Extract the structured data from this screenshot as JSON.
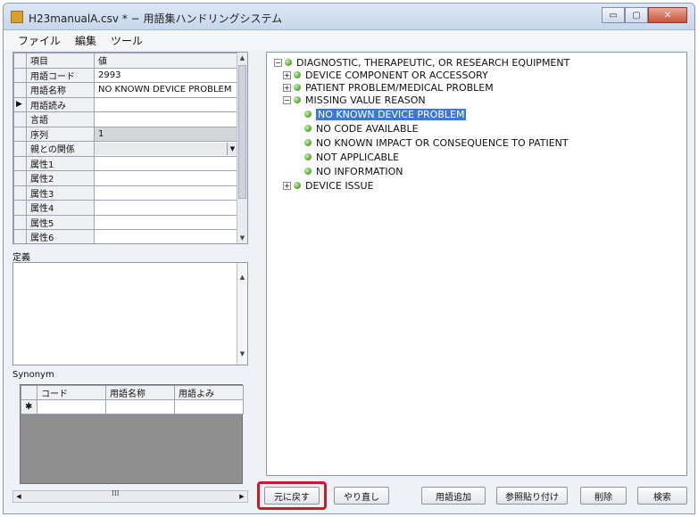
{
  "window": {
    "title": "H23manualA.csv * − 用語集ハンドリングシステム",
    "min": "▭",
    "max": "▢",
    "close": "✕"
  },
  "menu": [
    "ファイル",
    "編集",
    "ツール"
  ],
  "grid": {
    "headers": [
      "項目",
      "値"
    ],
    "current_marker": "▶",
    "rows": [
      {
        "key": "用語コード",
        "value": "2993"
      },
      {
        "key": "用語名称",
        "value": "NO KNOWN DEVICE PROBLEM"
      },
      {
        "key": "用語読み",
        "value": ""
      },
      {
        "key": "言語",
        "value": ""
      },
      {
        "key": "序列",
        "value": "1"
      },
      {
        "key": "親との関係",
        "value": ""
      },
      {
        "key": "属性1",
        "value": ""
      },
      {
        "key": "属性2",
        "value": ""
      },
      {
        "key": "属性3",
        "value": ""
      },
      {
        "key": "属性4",
        "value": ""
      },
      {
        "key": "属性5",
        "value": ""
      },
      {
        "key": "属性6",
        "value": ""
      }
    ]
  },
  "definition_label": "定義",
  "synonym": {
    "label": "Synonym",
    "headers": [
      "コード",
      "用語名称",
      "用語よみ"
    ],
    "new_row_marker": "✱"
  },
  "tree": [
    {
      "label": "DIAGNOSTIC, THERAPEUTIC, OR RESEARCH EQUIPMENT",
      "level": 0,
      "expander": "−"
    },
    {
      "label": "DEVICE COMPONENT OR ACCESSORY",
      "level": 1,
      "expander": "+"
    },
    {
      "label": "PATIENT PROBLEM/MEDICAL PROBLEM",
      "level": 1,
      "expander": "+"
    },
    {
      "label": "MISSING VALUE REASON",
      "level": 1,
      "expander": "−"
    },
    {
      "label": "NO KNOWN DEVICE PROBLEM",
      "level": 2,
      "expander": "",
      "selected": true
    },
    {
      "label": "NO CODE AVAILABLE",
      "level": 2,
      "expander": ""
    },
    {
      "label": "NO KNOWN IMPACT OR CONSEQUENCE TO PATIENT",
      "level": 2,
      "expander": ""
    },
    {
      "label": "NOT APPLICABLE",
      "level": 2,
      "expander": ""
    },
    {
      "label": "NO INFORMATION",
      "level": 2,
      "expander": ""
    },
    {
      "label": "DEVICE ISSUE",
      "level": 1,
      "expander": "+"
    }
  ],
  "buttons": {
    "undo": "元に戻す",
    "redo": "やり直し",
    "add_term": "用語追加",
    "paste_ref": "参照貼り付け",
    "delete": "削除",
    "search": "検索"
  },
  "colors": {
    "selection": "#3a79d6",
    "highlight_box": "#c41e2d",
    "node_dot": "#4ea62d"
  }
}
